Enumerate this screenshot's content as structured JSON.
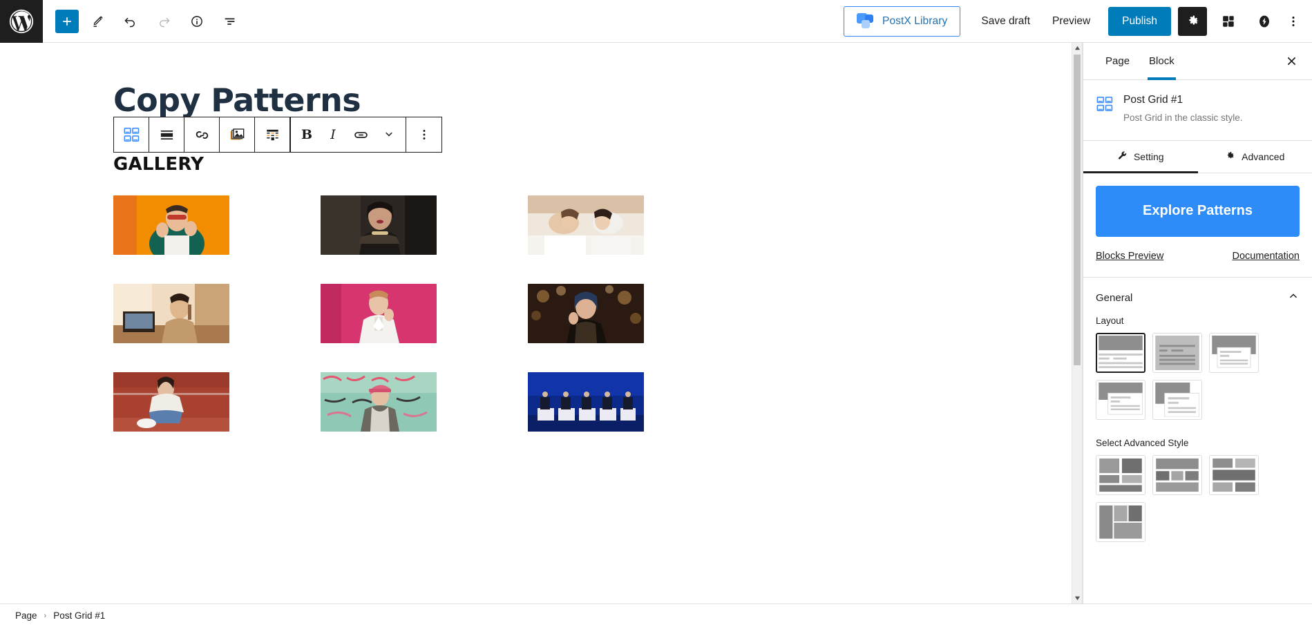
{
  "topbar": {
    "wp_logo": "wordpress-logo",
    "left_tools": [
      {
        "name": "add-block-button",
        "icon": "plus-icon",
        "label": "Toggle block inserter"
      },
      {
        "name": "tools-button",
        "icon": "pencil-icon",
        "label": "Tools"
      },
      {
        "name": "undo-button",
        "icon": "undo-icon",
        "label": "Undo"
      },
      {
        "name": "redo-button",
        "icon": "redo-icon",
        "label": "Redo"
      },
      {
        "name": "details-button",
        "icon": "info-icon",
        "label": "Details"
      },
      {
        "name": "list-view-button",
        "icon": "list-view-icon",
        "label": "List View"
      }
    ],
    "postx_library_label": "PostX Library",
    "save_draft_label": "Save draft",
    "preview_label": "Preview",
    "publish_label": "Publish",
    "settings_icon": "gear-icon",
    "blocks_icon": "blocks-icon",
    "postx_icon": "postx-badge-icon",
    "options_icon": "kebab-menu-icon"
  },
  "block_toolbar": {
    "items": [
      {
        "name": "block-type-postgrid-icon",
        "icon": "post-grid-icon"
      },
      {
        "name": "block-align-icon",
        "icon": "align-full-icon"
      },
      {
        "name": "block-link-icon",
        "icon": "chain-link-icon"
      },
      {
        "name": "block-images-icon",
        "icon": "images-stack-icon"
      },
      {
        "name": "block-layout-icon",
        "icon": "layout-grid-icon"
      }
    ],
    "bold_label": "B",
    "italic_label": "I",
    "link_icon": "link-icon",
    "chevron_icon": "chevron-down-icon",
    "more_icon": "kebab-menu-icon"
  },
  "canvas": {
    "post_title": "Copy Patterns",
    "gallery_heading": "GALLERY",
    "gallery_items": [
      {
        "name": "gallery-image-1",
        "alt": "woman in green jacket with red sunglasses on orange background",
        "palette": [
          "#f28c00",
          "#e8731a",
          "#17614f",
          "#f2d9c2"
        ]
      },
      {
        "name": "gallery-image-2",
        "alt": "portrait of woman with dark lipstick and feather top",
        "palette": [
          "#2b2622",
          "#6b5a4e",
          "#c99d86",
          "#120f0d"
        ]
      },
      {
        "name": "gallery-image-3",
        "alt": "two women lying down in white shirts",
        "palette": [
          "#e8d8c8",
          "#d8b79a",
          "#f4f2ee",
          "#c9a184"
        ]
      },
      {
        "name": "gallery-image-4",
        "alt": "woman at desk with laptop in warm light",
        "palette": [
          "#c79d6e",
          "#efdcc2",
          "#7a5a3a",
          "#2e241c"
        ]
      },
      {
        "name": "gallery-image-5",
        "alt": "man in white coat on pink background",
        "palette": [
          "#d6356f",
          "#b9295c",
          "#f3f1ee",
          "#e8e2dc"
        ]
      },
      {
        "name": "gallery-image-6",
        "alt": "woman with blue hair against bokeh lights",
        "palette": [
          "#2a1a12",
          "#b07a3c",
          "#e0b070",
          "#4a2c1c"
        ]
      },
      {
        "name": "gallery-image-7",
        "alt": "woman sitting on running track in jeans",
        "palette": [
          "#a8412f",
          "#b55040",
          "#e8e4e0",
          "#5a7fae"
        ]
      },
      {
        "name": "gallery-image-8",
        "alt": "man in pink cap in front of graffiti wall",
        "palette": [
          "#8fc8b4",
          "#d9758f",
          "#e6e2d8",
          "#3a3a3a"
        ]
      },
      {
        "name": "gallery-image-9",
        "alt": "panel of speakers on stage with blue lighting",
        "palette": [
          "#0c2a8a",
          "#1030b0",
          "#e8e8ef",
          "#0a1f66"
        ]
      }
    ],
    "scrollbar": {
      "name": "canvas-scrollbar"
    }
  },
  "sidebar": {
    "tabs": [
      {
        "name": "tab-page",
        "label": "Page",
        "active": false
      },
      {
        "name": "tab-block",
        "label": "Block",
        "active": true
      }
    ],
    "close_label": "Close settings",
    "block_card": {
      "icon": "post-grid-icon",
      "title": "Post Grid #1",
      "description": "Post Grid in the classic style."
    },
    "setting_tabs": [
      {
        "name": "tab-setting",
        "label": "Setting",
        "icon": "wrench-icon",
        "active": true
      },
      {
        "name": "tab-advanced",
        "label": "Advanced",
        "icon": "gear-icon",
        "active": false
      }
    ],
    "explore_patterns_label": "Explore Patterns",
    "blocks_preview_label": "Blocks Preview",
    "documentation_label": "Documentation",
    "general_section": {
      "title": "General",
      "collapse_icon": "chevron-up-icon",
      "layout_label": "Layout",
      "layout_options": [
        {
          "name": "layout-option-1",
          "variant": "hero-top",
          "selected": true
        },
        {
          "name": "layout-option-2",
          "variant": "full-overlay",
          "selected": false
        },
        {
          "name": "layout-option-3",
          "variant": "card-center",
          "selected": false
        },
        {
          "name": "layout-option-4",
          "variant": "card-right",
          "selected": false
        },
        {
          "name": "layout-option-5",
          "variant": "card-offset",
          "selected": false
        }
      ],
      "advanced_style_label": "Select Advanced Style",
      "advanced_style_options": [
        {
          "name": "advanced-style-option-1",
          "variant": "style-a",
          "selected": false
        },
        {
          "name": "advanced-style-option-2",
          "variant": "style-b",
          "selected": false
        },
        {
          "name": "advanced-style-option-3",
          "variant": "style-c",
          "selected": false
        },
        {
          "name": "advanced-style-option-4",
          "variant": "style-d",
          "selected": false
        }
      ]
    },
    "colors": {
      "accent": "#007cba",
      "explore_blue": "#2d8cf8",
      "dark": "#1e1e1e"
    }
  },
  "bottombar": {
    "breadcrumbs": [
      {
        "name": "breadcrumb-page",
        "label": "Page"
      },
      {
        "name": "breadcrumb-block",
        "label": "Post Grid #1"
      }
    ],
    "separator": "›"
  }
}
